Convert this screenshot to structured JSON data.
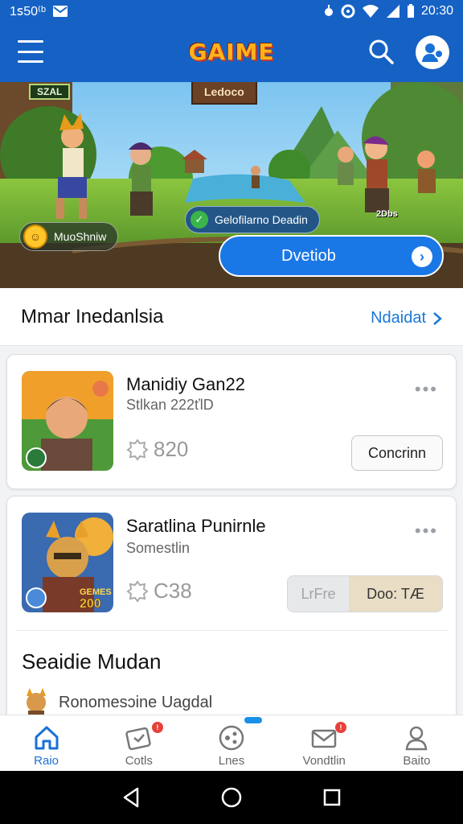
{
  "status_bar": {
    "left_text": "1ꜱ50⁽ᵇ",
    "mail_icon": "mail-icon",
    "time": "20:30",
    "icons": [
      "alarm-icon",
      "data-saver-icon",
      "wifi-icon",
      "signal-icon",
      "battery-icon"
    ]
  },
  "app_bar": {
    "logo": "GAIME",
    "icons": {
      "menu": "menu-icon",
      "search": "search-icon",
      "profile": "profile-icon"
    }
  },
  "hero": {
    "tag": "SZAL",
    "sign": "Ledoco",
    "left_badge": "MuoShniw",
    "left_badge_coin": "☺",
    "chip": "Gelofilarno Deadin",
    "mini": "2Dbs",
    "cta_label": "Dvetiob",
    "cta_icon": "chevron-right-icon"
  },
  "section": {
    "title": "Mmar Inedanlsia",
    "link": "Ndaidat"
  },
  "cards": [
    {
      "title": "Manidiy Gan22",
      "subtitle": "Stlkan 222ťlD",
      "stat": "820",
      "action": "Concrinn"
    },
    {
      "title": "Saratlina Punirnle",
      "subtitle": "Somestlin",
      "stat": "C38",
      "thumb_badge": "200",
      "thumb_label": "GEMES",
      "seg_left": "LrFre",
      "seg_right": "Doo: TÆ",
      "sub_title": "Seaidie Mudan",
      "sub_row": "Ronomesɔine Uagdal"
    }
  ],
  "bottom_nav": [
    {
      "label": "Raio",
      "icon": "home-icon",
      "active": true
    },
    {
      "label": "Cotls",
      "icon": "ticket-icon",
      "badge": "!"
    },
    {
      "label": "Lnes",
      "icon": "gamepad-icon",
      "indicator": true
    },
    {
      "label": "Vondtlin",
      "icon": "mail-icon",
      "badge": "!"
    },
    {
      "label": "Baito",
      "icon": "person-icon"
    }
  ],
  "system_nav": [
    "back-icon",
    "home-circle-icon",
    "recents-icon"
  ],
  "colors": {
    "primary": "#1662c4",
    "accent": "#1a78d8",
    "logo": "#ffb21a",
    "badge": "#e8413b"
  }
}
